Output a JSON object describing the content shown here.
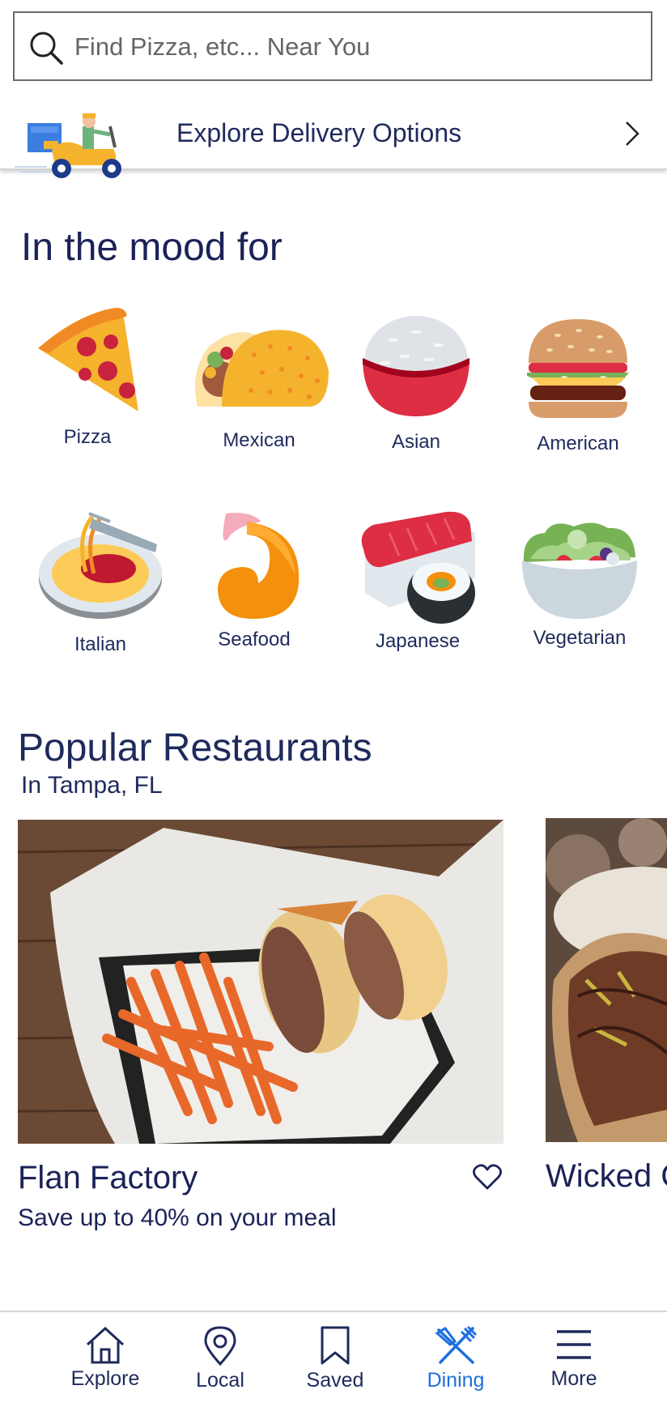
{
  "search": {
    "placeholder": "Find Pizza, etc... Near You"
  },
  "delivery": {
    "label": "Explore Delivery Options"
  },
  "mood": {
    "title": "In the mood for",
    "categories": [
      {
        "label": "Pizza"
      },
      {
        "label": "Mexican"
      },
      {
        "label": "Asian"
      },
      {
        "label": "American"
      },
      {
        "label": "Italian"
      },
      {
        "label": "Seafood"
      },
      {
        "label": "Japanese"
      },
      {
        "label": "Vegetarian"
      }
    ]
  },
  "popular": {
    "title": "Popular Restaurants",
    "subtitle": "In Tampa, FL",
    "restaurants": [
      {
        "name": "Flan Factory",
        "deal": "Save up to 40% on your meal"
      },
      {
        "name": "Wicked C"
      }
    ]
  },
  "nav": {
    "items": [
      {
        "label": "Explore",
        "icon": "home-icon"
      },
      {
        "label": "Local",
        "icon": "map-pin-icon"
      },
      {
        "label": "Saved",
        "icon": "bookmark-icon"
      },
      {
        "label": "Dining",
        "icon": "fork-knife-icon",
        "active": true
      },
      {
        "label": "More",
        "icon": "menu-icon"
      }
    ]
  },
  "colors": {
    "navy": "#1b2257",
    "active": "#1e6fe0",
    "pizza": "#f5b32d"
  }
}
